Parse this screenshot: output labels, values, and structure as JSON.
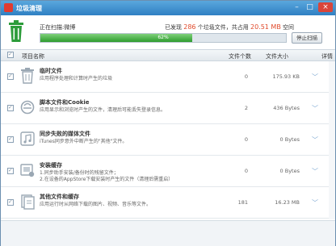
{
  "window": {
    "title": "垃圾清理",
    "min": "–",
    "max": "□",
    "close": "×"
  },
  "scan": {
    "status_label": "正在扫描:微博",
    "found_prefix": "已发现",
    "found_count": "286",
    "found_mid": "个垃圾文件，共占用",
    "found_size": "20.51 MB",
    "found_suffix": "空间",
    "progress_percent": 62,
    "progress_text": "62%",
    "stop_label": "停止扫描"
  },
  "columns": {
    "name": "项目名称",
    "count": "文件个数",
    "size": "文件大小",
    "detail": "详情"
  },
  "rows": [
    {
      "name": "临时文件",
      "desc": "应用程序处理和计算时产生的垃圾",
      "count": "0",
      "size": "175.93 KB",
      "icon": "trash-icon",
      "detail": "﹀"
    },
    {
      "name": "脚本文件和Cookie",
      "desc": "应用显示和浏览时产生的文件，清理后可能丢失登录信息。",
      "count": "2",
      "size": "436 Bytes",
      "icon": "browser-icon",
      "detail": "﹀"
    },
    {
      "name": "同步失败的媒体文件",
      "desc": "iTunes同步意外中断产生的\"其他\"文件。",
      "count": "0",
      "size": "0 Bytes",
      "icon": "music-icon",
      "detail": "﹀"
    },
    {
      "name": "安装缓存",
      "desc": "1.同步助手安装/备份时的残留文件；\n2.在设备的AppStore下载安装时产生的文件（清理后需重启）",
      "count": "0",
      "size": "0 Bytes",
      "icon": "install-cache-icon",
      "detail": "﹀"
    },
    {
      "name": "其他文件和缓存",
      "desc": "应用运行时从网络下载的图片、视频、音乐等文件。",
      "count": "181",
      "size": "16.23 MB",
      "icon": "cache-icon",
      "detail": "﹀"
    }
  ],
  "colors": {
    "title_bar": "#2f80c3",
    "progress": "#2e9c2e",
    "accent_red": "#e04a2b",
    "detail_arrow": "#7aa6d1"
  }
}
